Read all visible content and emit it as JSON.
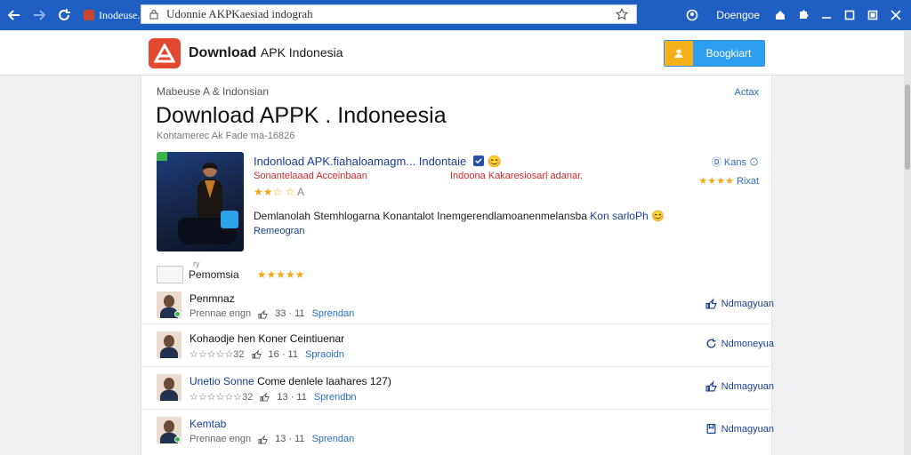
{
  "browser": {
    "tab_title": "Inodeuse.",
    "url": "Udonnie AKPKaesiad indograh",
    "profile_label": "Doengoe"
  },
  "site": {
    "name": "Download",
    "name_sub": "APK Indonesia",
    "header_button": "Boogkiart"
  },
  "page": {
    "breadcrumb": "Mabeuse A & Indonsian",
    "top_link": "Actax",
    "title": "Download APPK . Indoneesia",
    "meta": "Kontamerec Ak Fade ma-16826"
  },
  "app": {
    "name": "Indonload APK.fiahaloamagm... Indontaie",
    "tag_left": "Sonantelaaad Acceinbaan",
    "tag_right": "Indoona Kakaresiosarl adanar.",
    "rating_text": "A",
    "rating_stars": "★★☆ ☆",
    "right_pill": "Ⓓ Kans ⊙",
    "right_rating_stars": "★★★★",
    "right_rating_text": "Rixat",
    "description": "Demlanolah Stemhlogarna Konantalot Inemgerendlamoanenmelansba",
    "description_highlight": "Kon sarloPh",
    "description_emoji": "😊",
    "description_link": "Remeogran"
  },
  "reviews_section": {
    "meta": "ry",
    "title": "Pemomsia",
    "stars": "★★★★★"
  },
  "reviews": [
    {
      "name": "Penmnaz",
      "name_blue": "",
      "stars": "Prennae engn",
      "count": "33 · 11",
      "link": "Sprendan",
      "action": "Ndmagyuan"
    },
    {
      "name": "Kohaodje hen Koner Ceintiuenar",
      "name_blue": "",
      "stars": "☆☆☆☆☆32",
      "count": "16 · 11",
      "link": "Spraoidn",
      "action": "Ndmoneyua"
    },
    {
      "name": "Come denlele laahares 127)",
      "name_blue": "Unetio Sonne",
      "stars": "☆☆☆☆☆☆32",
      "count": "13 · 11",
      "link": "Sprendbn",
      "action": "Ndmagyuan"
    },
    {
      "name": "Kemtab",
      "name_blue": "",
      "stars": "Prennae engn",
      "count": "13 · 11",
      "link": "Sprendan",
      "action": "Ndmagyuan"
    }
  ],
  "colors": {
    "chrome": "#1f5fc4",
    "accent_blue": "#1a3d8f",
    "accent_red": "#d1272b",
    "star": "#f2a818",
    "button_blue": "#2e9ef0",
    "button_orange": "#f5b11b"
  }
}
